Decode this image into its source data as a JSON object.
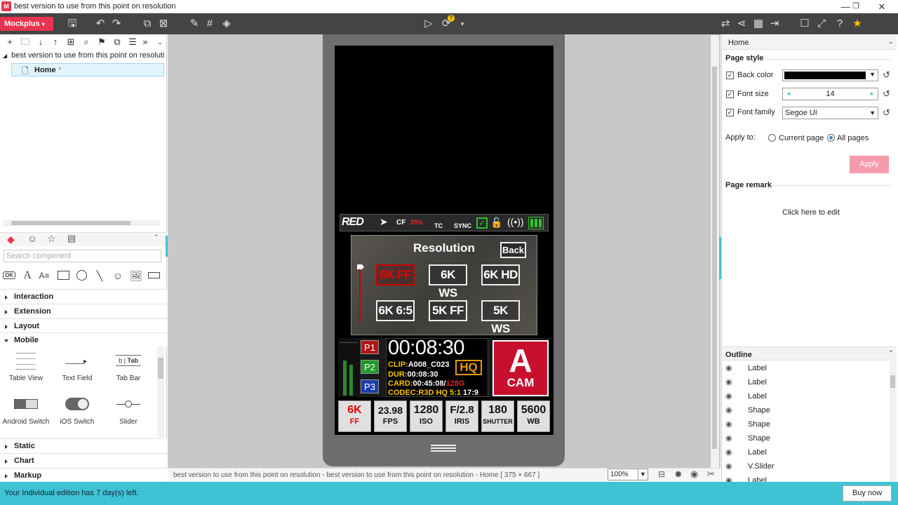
{
  "window": {
    "title": "best version to use from this point on resolution",
    "app_badge": "M"
  },
  "toolbar": {
    "brand": "Mockplus",
    "sync_badge": "?"
  },
  "tree": {
    "root": "best version to use from this point on resoluti",
    "home": "Home",
    "home_marker": "*"
  },
  "components": {
    "search_placeholder": "Search component",
    "categories": [
      "Interaction",
      "Extension",
      "Layout",
      "Mobile",
      "Static",
      "Chart",
      "Markup"
    ],
    "mobile_items": [
      "Table View",
      "Text Field",
      "Tab Bar",
      "Android Switch",
      "iOS Switch",
      "Slider"
    ],
    "tab_bar_preview": [
      "b",
      "Tab"
    ]
  },
  "phone": {
    "status": {
      "brand": "RED",
      "cf": "CF",
      "cf_pct": "35%",
      "tc": "TC",
      "sync": "SYNC"
    },
    "resolution": {
      "title": "Resolution",
      "back": "Back",
      "options": [
        "6K FF",
        "6K WS",
        "6K HD",
        "6K 6:5",
        "5K FF",
        "5K WS"
      ],
      "selected": "6K FF"
    },
    "presets": [
      "P1",
      "P2",
      "P3"
    ],
    "timecode": "00:08:30",
    "clip_label": "CLIP:",
    "clip": "A008_C023",
    "dur_label": "DUR:",
    "dur": "00:08:30",
    "card_label": "CARD:",
    "card": "00:45:08/",
    "card_cap": "128G",
    "codec_label": "CODEC:",
    "codec": "R3D HQ 5:1",
    "aspect": "17:9",
    "quality": "HQ",
    "cam_letter": "A",
    "cam_label": "CAM",
    "settings": [
      {
        "value": "6K",
        "label": "FF"
      },
      {
        "value": "23.98",
        "label": "FPS"
      },
      {
        "value": "1280",
        "label": "ISO"
      },
      {
        "value": "F/2.8",
        "label": "IRIS"
      },
      {
        "value": "180",
        "label": "SHUTTER"
      },
      {
        "value": "5600",
        "label": "WB"
      }
    ]
  },
  "canvas": {
    "statusline": "best version to use from this point on resolution - best version to use from this point on resolution - Home [ 375 × 667 ]",
    "zoom": "100%"
  },
  "properties": {
    "page_name": "Home",
    "page_style": "Page style",
    "back_color_label": "Back color",
    "back_color": "#000000",
    "font_size_label": "Font size",
    "font_size": "14",
    "font_family_label": "Font family",
    "font_family": "Segoe UI",
    "apply_to_label": "Apply to:",
    "current_page": "Current page",
    "all_pages": "All pages",
    "apply_button": "Apply",
    "page_remark": "Page remark",
    "remark_hint": "Click here to edit"
  },
  "outline": {
    "title": "Outline",
    "rows": [
      "Label",
      "Label",
      "Label",
      "Shape",
      "Shape",
      "Shape",
      "Label",
      "V.Slider",
      "Label"
    ]
  },
  "footer": {
    "trial": "Your Individual edition has 7 day(s) left.",
    "buy": "Buy now"
  },
  "colors": {
    "brand": "#e8344e",
    "accent_cyan": "#3ec3d5",
    "red": "#c8102e",
    "preset_red": "#b01818",
    "preset_green": "#1f9a2a",
    "preset_blue": "#1d3ea8"
  }
}
